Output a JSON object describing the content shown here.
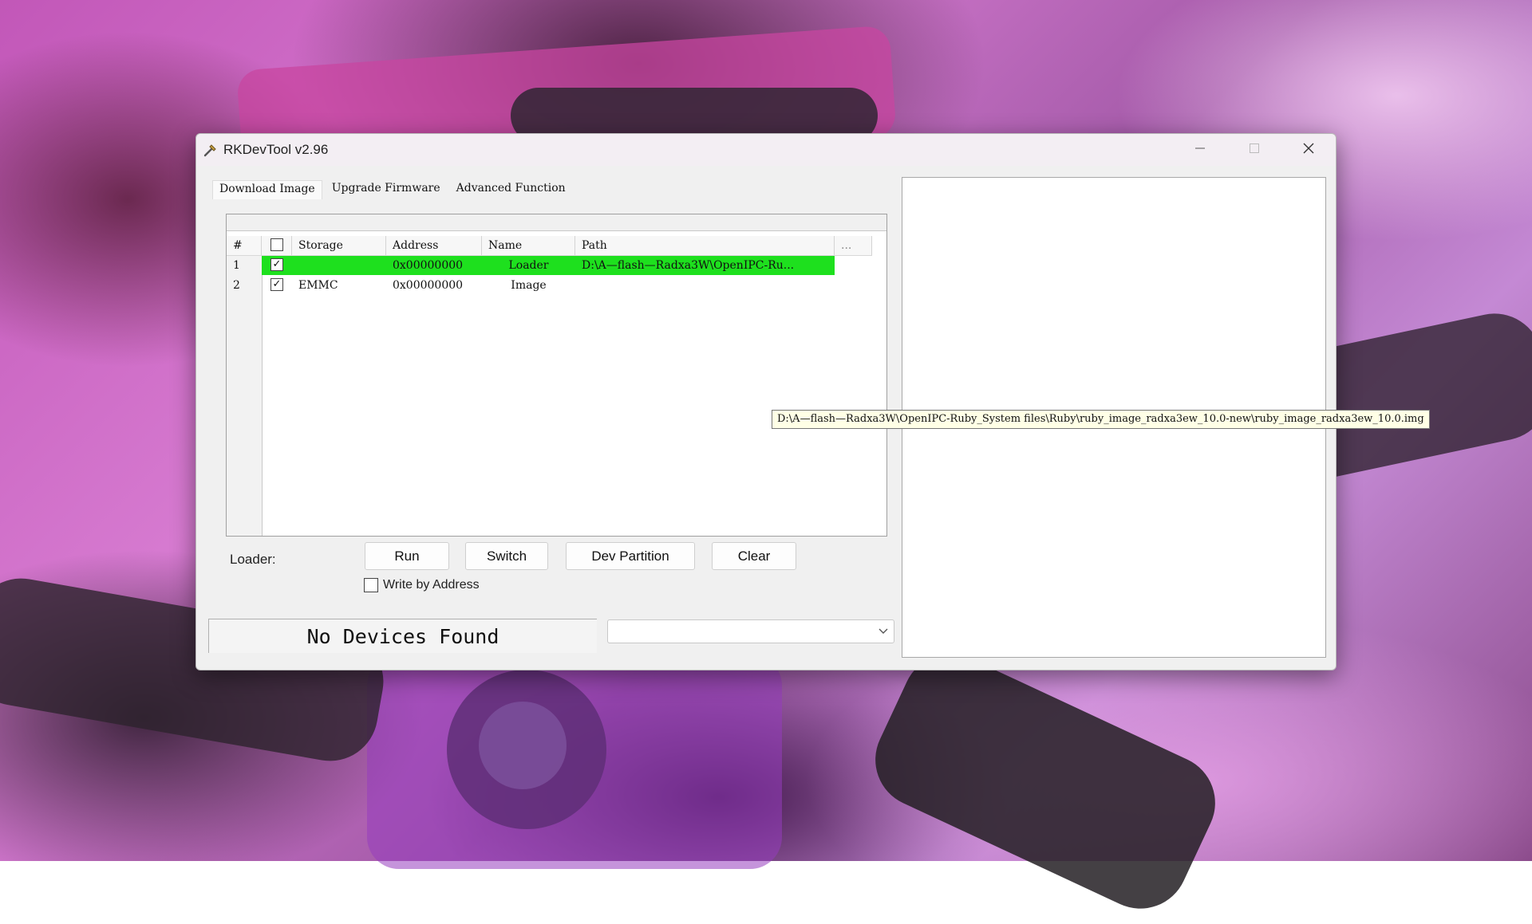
{
  "window": {
    "title": "RKDevTool v2.96"
  },
  "tabs": [
    {
      "label": "Download Image",
      "active": true
    },
    {
      "label": "Upgrade Firmware",
      "active": false
    },
    {
      "label": "Advanced Function",
      "active": false
    }
  ],
  "table": {
    "headers": {
      "num": "#",
      "storage": "Storage",
      "address": "Address",
      "name": "Name",
      "path": "Path",
      "more": "..."
    },
    "rows": [
      {
        "num": "1",
        "checked": "✓",
        "storage": "",
        "address": "0x00000000",
        "name": "Loader",
        "path": "D:\\A—flash—Radxa3W\\OpenIPC-Ru...",
        "highlighted": true
      },
      {
        "num": "2",
        "checked": "✓",
        "storage": "EMMC",
        "address": "0x00000000",
        "name": "Image",
        "path": "D:\\A—flash—Radxa3W\\OpenIPC-Ruby_System files\\Ruby\\ruby_image_radxa3ew_10.0-new\\ruby_image_radxa3ew_10.0.img",
        "highlighted": false
      }
    ],
    "tooltip": "D:\\A—flash—Radxa3W\\OpenIPC-Ruby_System files\\Ruby\\ruby_image_radxa3ew_10.0-new\\ruby_image_radxa3ew_10.0.img"
  },
  "controls": {
    "loader_label": "Loader:",
    "run_label": "Run",
    "switch_label": "Switch",
    "dev_partition_label": "Dev Partition",
    "clear_label": "Clear",
    "write_by_address_label": "Write by Address",
    "write_by_address_checked": false
  },
  "status": {
    "text": "No Devices Found",
    "device_select_value": ""
  },
  "colors": {
    "highlight_row": "#1ee01e",
    "tooltip_bg": "#ffffe6",
    "window_bg": "#f0f0f0"
  },
  "icons": {
    "app": "rk-tool-icon",
    "minimize": "minimize-icon",
    "maximize": "maximize-icon",
    "close": "close-icon",
    "dropdown": "chevron-down-icon"
  }
}
